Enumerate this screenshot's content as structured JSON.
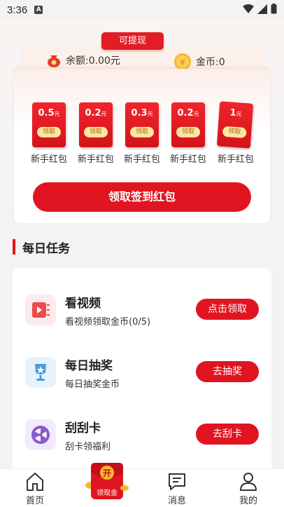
{
  "status_bar": {
    "time": "3:36",
    "notif_icon": "A"
  },
  "header": {
    "withdraw_badge": "可提现"
  },
  "balance": {
    "money_label": "余额:0.00元",
    "coin_label": "金币:0"
  },
  "packets": [
    {
      "amount": "0.5",
      "unit": "元",
      "take": "领取",
      "label": "新手红包"
    },
    {
      "amount": "0.2",
      "unit": "元",
      "take": "领取",
      "label": "新手红包"
    },
    {
      "amount": "0.3",
      "unit": "元",
      "take": "领取",
      "label": "新手红包"
    },
    {
      "amount": "0.2",
      "unit": "元",
      "take": "领取",
      "label": "新手红包"
    },
    {
      "amount": "1",
      "unit": "元",
      "take": "领取",
      "label": "新手红包"
    }
  ],
  "sign_button": "领取签到红包",
  "section": {
    "title": "每日任务"
  },
  "tasks": [
    {
      "title": "看视频",
      "subtitle": "看视频领取金币(0/5)",
      "button": "点击领取",
      "icon": "video-icon"
    },
    {
      "title": "每日抽奖",
      "subtitle": "每日抽奖金币",
      "button": "去抽奖",
      "icon": "trophy-icon"
    },
    {
      "title": "刮刮卡",
      "subtitle": "刮卡领福利",
      "button": "去刮卡",
      "icon": "wheel-icon"
    }
  ],
  "tabbar": {
    "home": "首页",
    "center_badge": "开",
    "center_label": "领现金",
    "messages": "消息",
    "mine": "我的"
  },
  "colors": {
    "accent": "#e01521",
    "gold": "#f5b82e"
  }
}
